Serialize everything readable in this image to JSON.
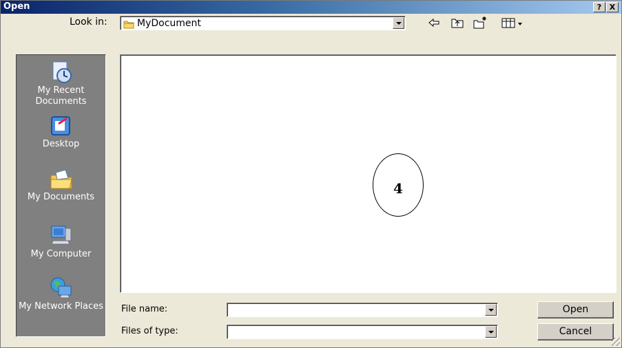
{
  "window": {
    "title": "Open",
    "help_label": "?",
    "close_label": "X"
  },
  "toolbar": {
    "look_in_label": "Look in:",
    "look_in_value": "MyDocument"
  },
  "places": [
    {
      "label": "My Recent Documents",
      "icon": "recent-documents-icon"
    },
    {
      "label": "Desktop",
      "icon": "desktop-icon"
    },
    {
      "label": "My Documents",
      "icon": "my-documents-icon"
    },
    {
      "label": "My Computer",
      "icon": "my-computer-icon"
    },
    {
      "label": "My Network Places",
      "icon": "network-places-icon"
    }
  ],
  "annotation": {
    "number": "4"
  },
  "form": {
    "file_name_label": "File name:",
    "file_name_value": "",
    "file_type_label": "Files of type:",
    "file_type_value": ""
  },
  "buttons": {
    "open": "Open",
    "cancel": "Cancel"
  },
  "colors": {
    "title_start": "#0a246a",
    "title_end": "#a6caf0",
    "face": "#ece9d8",
    "places_bg": "#808080"
  }
}
